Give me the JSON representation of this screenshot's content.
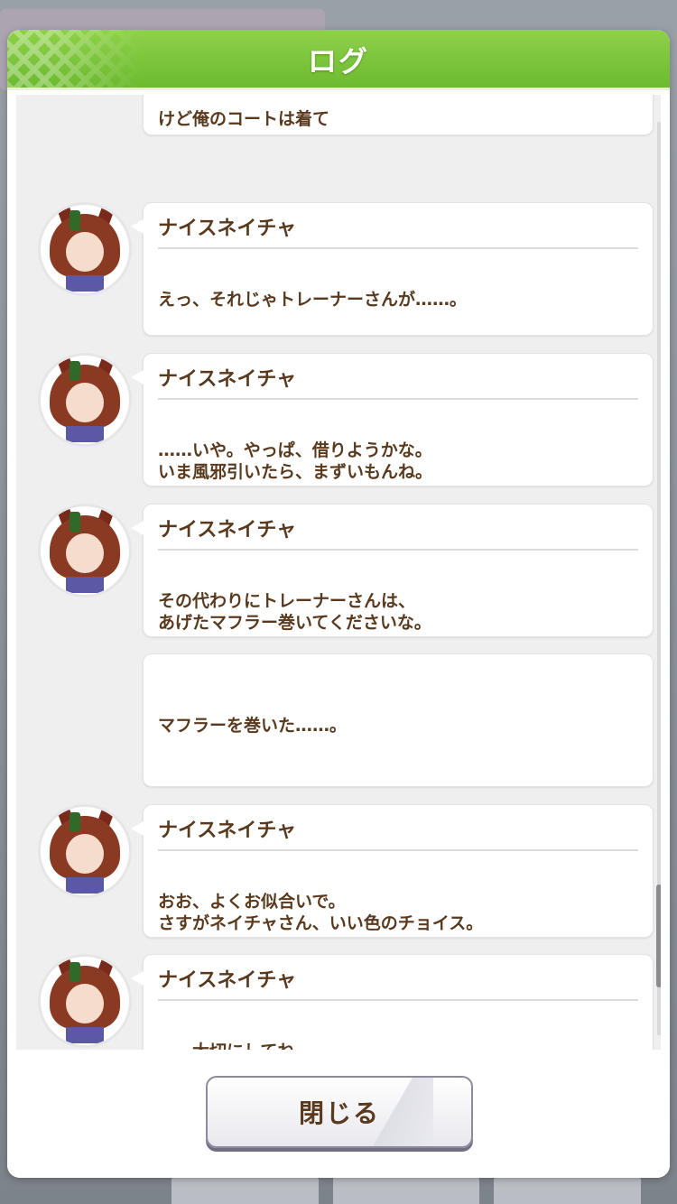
{
  "dialog": {
    "title": "ログ",
    "close_label": "閉じる"
  },
  "log": {
    "partial_text": "けど俺のコートは着て",
    "entries": [
      {
        "speaker": "ナイスネイチャ",
        "lines": [
          "えっ、それじゃトレーナーさんが……。"
        ]
      },
      {
        "speaker": "ナイスネイチャ",
        "lines": [
          "……いや。やっぱ、借りようかな。",
          "いま風邪引いたら、まずいもんね。"
        ]
      },
      {
        "speaker": "ナイスネイチャ",
        "lines": [
          "その代わりにトレーナーさんは、",
          "あげたマフラー巻いてくださいな。"
        ]
      },
      {
        "speaker": "",
        "lines": [
          "マフラーを巻いた……。"
        ]
      },
      {
        "speaker": "ナイスネイチャ",
        "lines": [
          "おお、よくお似合いで。",
          "さすがネイチャさん、いい色のチョイス。"
        ]
      },
      {
        "speaker": "ナイスネイチャ",
        "lines": [
          "……大切にしてね。"
        ]
      }
    ]
  },
  "colors": {
    "header_green": "#7cc63a",
    "text_brown": "#5a3a1e",
    "log_background": "#efeff0"
  },
  "icons": {
    "avatar": "nice-nature-avatar-icon"
  }
}
